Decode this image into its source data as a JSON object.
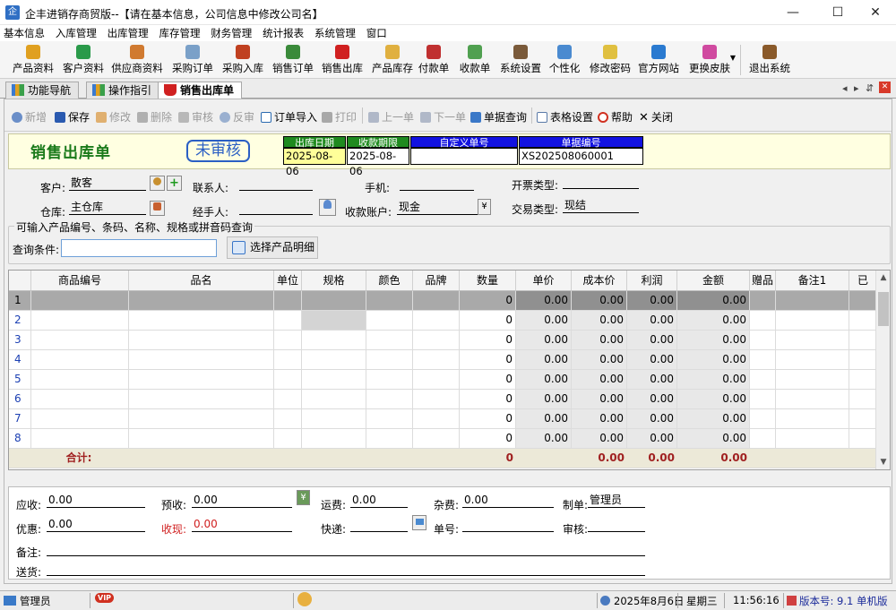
{
  "window": {
    "title": "企丰进销存商贸版--【请在基本信息，公司信息中修改公司名】",
    "icon_text": "企"
  },
  "menu": [
    "基本信息",
    "入库管理",
    "出库管理",
    "库存管理",
    "财务管理",
    "统计报表",
    "系统管理",
    "窗口"
  ],
  "toolbar": [
    {
      "label": "产品资料",
      "color": "#e0a020"
    },
    {
      "label": "客户资料",
      "color": "#2a9a4a"
    },
    {
      "label": "供应商资料",
      "color": "#d07a30"
    },
    {
      "label": "采购订单",
      "color": "#7aa0c8"
    },
    {
      "label": "采购入库",
      "color": "#c04020"
    },
    {
      "label": "销售订单",
      "color": "#3a8a3a"
    },
    {
      "label": "销售出库",
      "color": "#d02020"
    },
    {
      "label": "产品库存",
      "color": "#e0b040"
    },
    {
      "label": "付款单",
      "color": "#c03030"
    },
    {
      "label": "收款单",
      "color": "#50a050"
    },
    {
      "label": "系统设置",
      "color": "#7a5a3a"
    },
    {
      "label": "个性化",
      "color": "#4a8ad0"
    },
    {
      "label": "修改密码",
      "color": "#e0c040"
    },
    {
      "label": "官方网站",
      "color": "#2a7ad0"
    },
    {
      "label": "更换皮肤",
      "color": "#d04aa0"
    },
    {
      "label": "退出系统",
      "color": "#8a5a2a"
    }
  ],
  "tabs": [
    {
      "label": "功能导航"
    },
    {
      "label": "操作指引"
    },
    {
      "label": "销售出库单"
    }
  ],
  "tab_controls": {
    "prev": "◂",
    "next": "▸",
    "more": "⇵",
    "close": "✕"
  },
  "actions": {
    "new": "新增",
    "save": "保存",
    "edit": "修改",
    "delete": "删除",
    "audit": "审核",
    "unaudit": "反审",
    "import": "订单导入",
    "print": "打印",
    "prev": "上一单",
    "next": "下一单",
    "query": "单据查询",
    "table_settings": "表格设置",
    "help": "帮助",
    "close": "关闭"
  },
  "doc": {
    "title": "销售出库单",
    "status": "未审核",
    "out_date_label": "出库日期",
    "out_date": "2025-08-06",
    "due_label": "收款期限",
    "due_date": "2025-08-06",
    "custom_no_label": "自定义单号",
    "custom_no": "",
    "doc_no_label": "单据编号",
    "doc_no": "XS202508060001"
  },
  "form": {
    "customer_label": "客户:",
    "customer": "散客",
    "contact_label": "联系人:",
    "contact": "",
    "phone_label": "手机:",
    "phone": "",
    "invoice_label": "开票类型:",
    "invoice": "",
    "warehouse_label": "仓库:",
    "warehouse": "主仓库",
    "handler_label": "经手人:",
    "handler": "",
    "account_label": "收款账户:",
    "account": "现金",
    "trade_label": "交易类型:",
    "trade": "现结"
  },
  "query": {
    "group_title": "可输入产品编号、条码、名称、规格或拼音码查询",
    "label": "查询条件:",
    "value": "",
    "select_button": "选择产品明细"
  },
  "grid": {
    "headers": [
      "",
      "商品编号",
      "品名",
      "单位",
      "规格",
      "颜色",
      "品牌",
      "数量",
      "单价",
      "成本价",
      "利润",
      "金额",
      "赠品",
      "备注1",
      "已"
    ],
    "rows": [
      {
        "n": "1",
        "qty": "0",
        "price": "0.00",
        "cost": "0.00",
        "profit": "0.00",
        "amount": "0.00"
      },
      {
        "n": "2",
        "qty": "0",
        "price": "0.00",
        "cost": "0.00",
        "profit": "0.00",
        "amount": "0.00"
      },
      {
        "n": "3",
        "qty": "0",
        "price": "0.00",
        "cost": "0.00",
        "profit": "0.00",
        "amount": "0.00"
      },
      {
        "n": "4",
        "qty": "0",
        "price": "0.00",
        "cost": "0.00",
        "profit": "0.00",
        "amount": "0.00"
      },
      {
        "n": "5",
        "qty": "0",
        "price": "0.00",
        "cost": "0.00",
        "profit": "0.00",
        "amount": "0.00"
      },
      {
        "n": "6",
        "qty": "0",
        "price": "0.00",
        "cost": "0.00",
        "profit": "0.00",
        "amount": "0.00"
      },
      {
        "n": "7",
        "qty": "0",
        "price": "0.00",
        "cost": "0.00",
        "profit": "0.00",
        "amount": "0.00"
      },
      {
        "n": "8",
        "qty": "0",
        "price": "0.00",
        "cost": "0.00",
        "profit": "0.00",
        "amount": "0.00"
      }
    ],
    "total": {
      "label": "合计:",
      "qty": "0",
      "cost": "0.00",
      "profit": "0.00",
      "amount": "0.00",
      "price": "0.00"
    }
  },
  "footer": {
    "receivable_label": "应收:",
    "receivable": "0.00",
    "prepaid_label": "预收:",
    "prepaid": "0.00",
    "freight_label": "运费:",
    "freight": "0.00",
    "misc_label": "杂费:",
    "misc": "0.00",
    "maker_label": "制单:",
    "maker": "管理员",
    "discount_label": "优惠:",
    "discount": "0.00",
    "received_label": "收现:",
    "received": "0.00",
    "express_label": "快递:",
    "express": "",
    "tracking_label": "单号:",
    "tracking": "",
    "auditor_label": "审核:",
    "auditor": "",
    "remark_label": "备注:",
    "remark": "",
    "delivery_label": "送货:",
    "delivery": ""
  },
  "status": {
    "user": "管理员",
    "vip": "VIP",
    "date": "2025年8月6日",
    "weekday": "星期三",
    "time": "11:56:16",
    "version": "版本号: 9.1 单机版"
  }
}
